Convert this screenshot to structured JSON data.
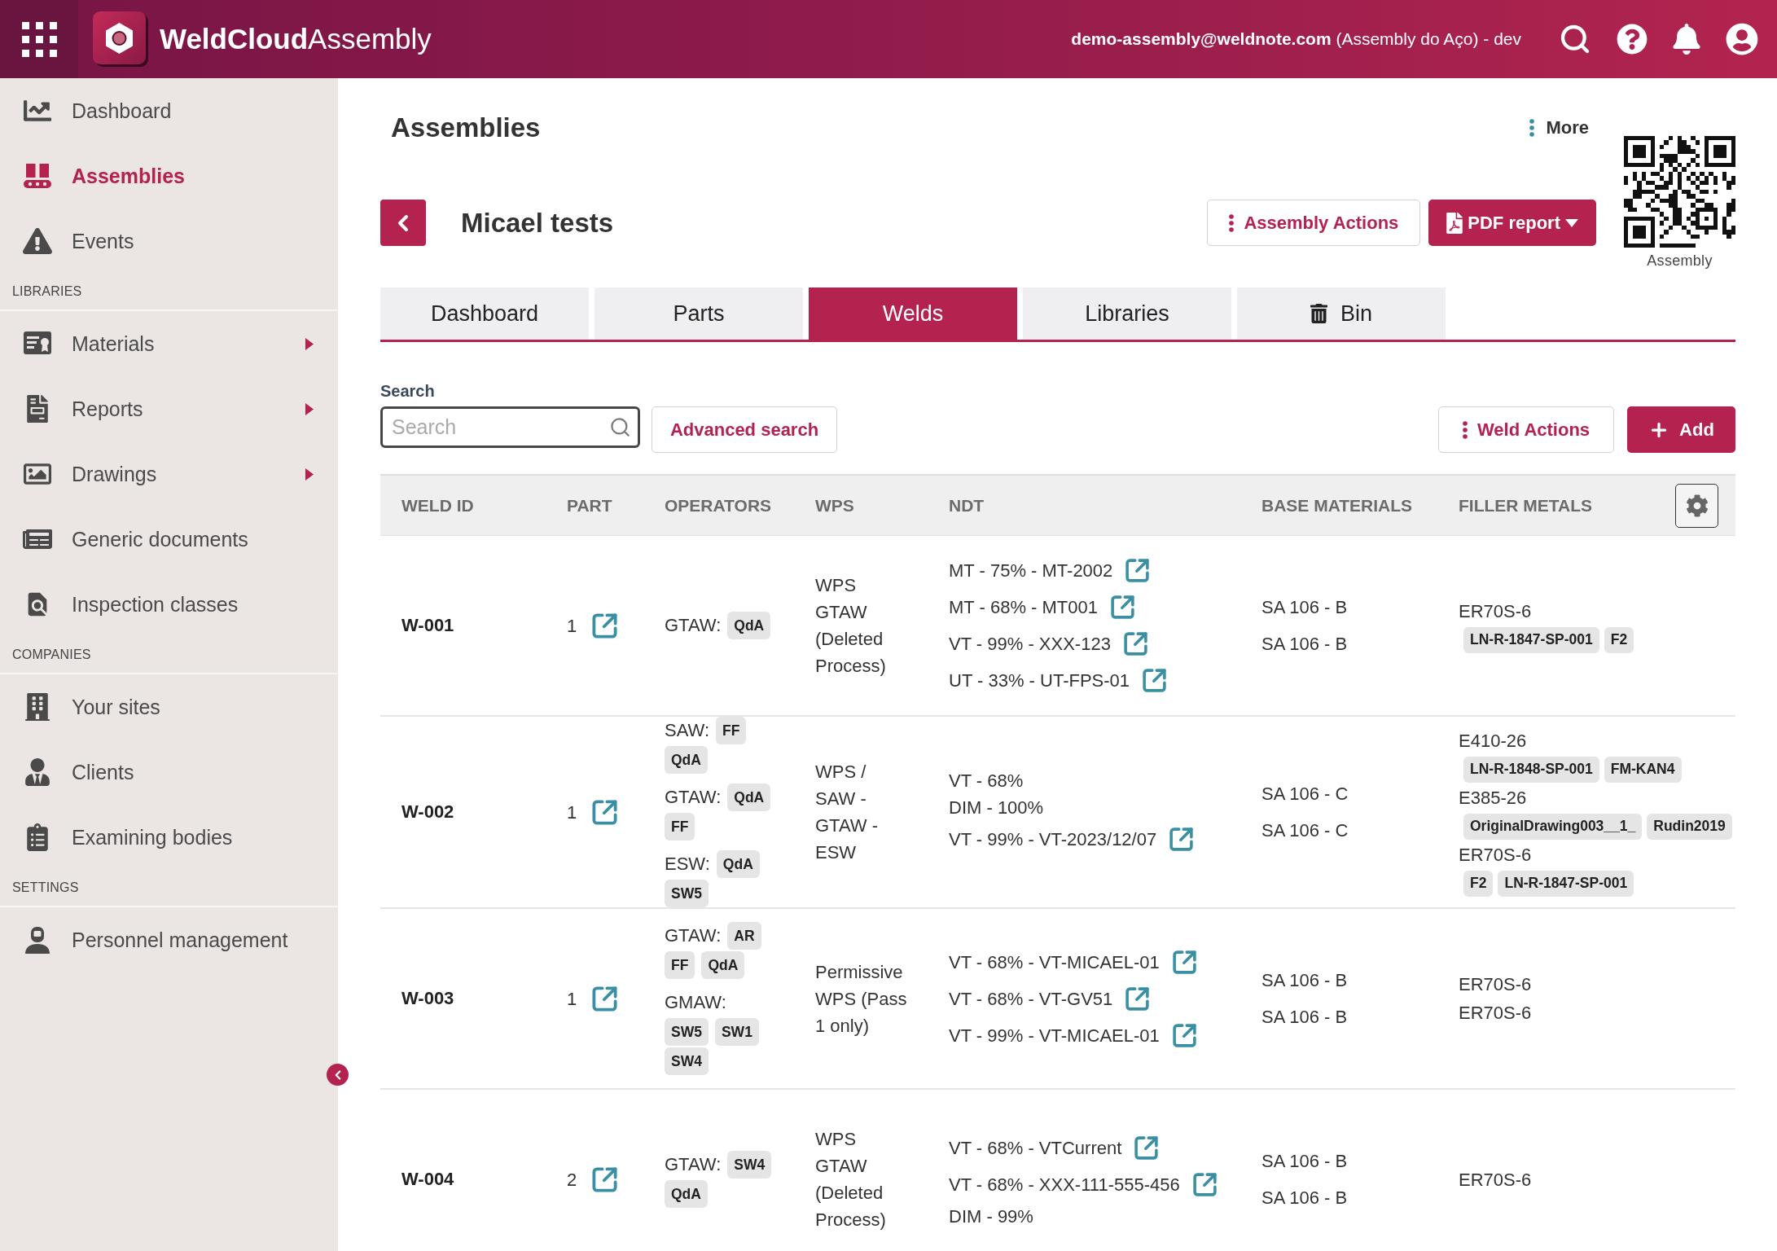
{
  "header": {
    "brand": "**WeldCloud**Assembly",
    "account": "**demo-assembly@weldnote.com** (Assembly do Aço) - dev"
  },
  "sidebar": {
    "sections": [
      {
        "items": [
          {
            "label": "Dashboard",
            "kind": "link",
            "selected": false
          },
          {
            "label": "Assemblies",
            "kind": "link",
            "selected": true
          },
          {
            "label": "Events",
            "kind": "link",
            "selected": false
          }
        ]
      },
      {
        "title": "LIBRARIES",
        "items": [
          {
            "label": "Materials",
            "kind": "menu",
            "selected": false
          },
          {
            "label": "Reports",
            "kind": "menu",
            "selected": false
          },
          {
            "label": "Drawings",
            "kind": "menu",
            "selected": false
          },
          {
            "label": "Generic documents",
            "kind": "link",
            "selected": false
          },
          {
            "label": "Inspection classes",
            "kind": "link",
            "selected": false
          }
        ]
      },
      {
        "title": "COMPANIES",
        "items": [
          {
            "label": "Your sites",
            "kind": "link",
            "selected": false
          },
          {
            "label": "Clients",
            "kind": "link",
            "selected": false
          },
          {
            "label": "Examining bodies",
            "kind": "link",
            "selected": false
          }
        ]
      },
      {
        "title": "SETTINGS",
        "items": [
          {
            "label": "Personnel management",
            "kind": "link",
            "selected": false
          }
        ]
      }
    ]
  },
  "page": {
    "title": "Assemblies",
    "more": "More",
    "qr_caption": "Assembly"
  },
  "assembly": {
    "name": "Micael tests",
    "actions_button": "Assembly Actions",
    "pdf_button": "PDF report"
  },
  "tabs": [
    {
      "label": "Dashboard",
      "selected": false
    },
    {
      "label": "Parts",
      "selected": false
    },
    {
      "label": "Welds",
      "selected": true
    },
    {
      "label": "Libraries",
      "selected": false
    },
    {
      "label": "Bin",
      "selected": false
    }
  ],
  "search": {
    "label": "Search",
    "placeholder": "Search",
    "advanced_button": "Advanced search"
  },
  "weld_actions_button": "Weld Actions",
  "add_button": "Add",
  "table": {
    "columns": [
      "WELD ID",
      "PART",
      "OPERATORS",
      "WPS",
      "NDT",
      "BASE MATERIALS",
      "FILLER METALS"
    ],
    "rows": [
      {
        "weld_id": "W-001",
        "part": "1",
        "operators": [
          {
            "process": "GTAW:",
            "tags": [
              "QdA"
            ]
          }
        ],
        "wps": "WPS GTAW (Deleted Process)",
        "ndt": [
          {
            "text": "MT - 75% - MT-2002",
            "linked": true
          },
          {
            "text": "MT - 68% - MT001",
            "linked": true
          },
          {
            "text": "VT - 99% - XXX-123",
            "linked": true
          },
          {
            "text": "UT - 33% - UT-FPS-01",
            "linked": true
          }
        ],
        "base_materials": [
          "SA 106 - B",
          "SA 106 - B"
        ],
        "filler_metals": [
          {
            "name": "ER70S-6",
            "tags": [
              "LN-R-1847-SP-001",
              "F2"
            ]
          }
        ]
      },
      {
        "weld_id": "W-002",
        "part": "1",
        "operators": [
          {
            "process": "SAW:",
            "tags": [
              "FF",
              "QdA"
            ]
          },
          {
            "process": "GTAW:",
            "tags": [
              "QdA",
              "FF"
            ]
          },
          {
            "process": "ESW:",
            "tags": [
              "QdA",
              "SW5"
            ]
          }
        ],
        "wps": "WPS / SAW - GTAW - ESW",
        "ndt": [
          {
            "text": "VT - 68%",
            "linked": false
          },
          {
            "text": "DIM - 100%",
            "linked": false
          },
          {
            "text": "VT - 99% - VT-2023/12/07",
            "linked": true
          }
        ],
        "base_materials": [
          "SA 106 - C",
          "SA 106 - C"
        ],
        "filler_metals": [
          {
            "name": "E410-26",
            "tags": [
              "LN-R-1848-SP-001",
              "FM-KAN4"
            ]
          },
          {
            "name": "E385-26",
            "tags": [
              "OriginalDrawing003__1_",
              "Rudin2019"
            ]
          },
          {
            "name": "ER70S-6",
            "tags": [
              "F2",
              "LN-R-1847-SP-001"
            ]
          }
        ]
      },
      {
        "weld_id": "W-003",
        "part": "1",
        "operators": [
          {
            "process": "GTAW:",
            "tags": [
              "AR",
              "FF",
              "QdA"
            ]
          },
          {
            "process": "GMAW:",
            "tags": [
              "SW5",
              "SW1",
              "SW4"
            ]
          }
        ],
        "wps": "Permissive WPS (Pass 1 only)",
        "ndt": [
          {
            "text": "VT - 68% - VT-MICAEL-01",
            "linked": true
          },
          {
            "text": "VT - 68% - VT-GV51",
            "linked": true
          },
          {
            "text": "VT - 99% - VT-MICAEL-01",
            "linked": true
          }
        ],
        "base_materials": [
          "SA 106 - B",
          "SA 106 - B"
        ],
        "filler_metals": [
          {
            "name": "ER70S-6"
          },
          {
            "name": "ER70S-6"
          }
        ]
      },
      {
        "weld_id": "W-004",
        "part": "2",
        "operators": [
          {
            "process": "GTAW:",
            "tags": [
              "SW4",
              "QdA"
            ]
          }
        ],
        "wps": "WPS GTAW (Deleted Process)",
        "ndt": [
          {
            "text": "VT - 68% - VTCurrent",
            "linked": true
          },
          {
            "text": "VT - 68% - XXX-111-555-456",
            "linked": true
          },
          {
            "text": "DIM - 99%",
            "linked": false
          }
        ],
        "base_materials": [
          "SA 106 - B",
          "SA 106 - B"
        ],
        "filler_metals": [
          {
            "name": "ER70S-6"
          }
        ]
      }
    ]
  }
}
